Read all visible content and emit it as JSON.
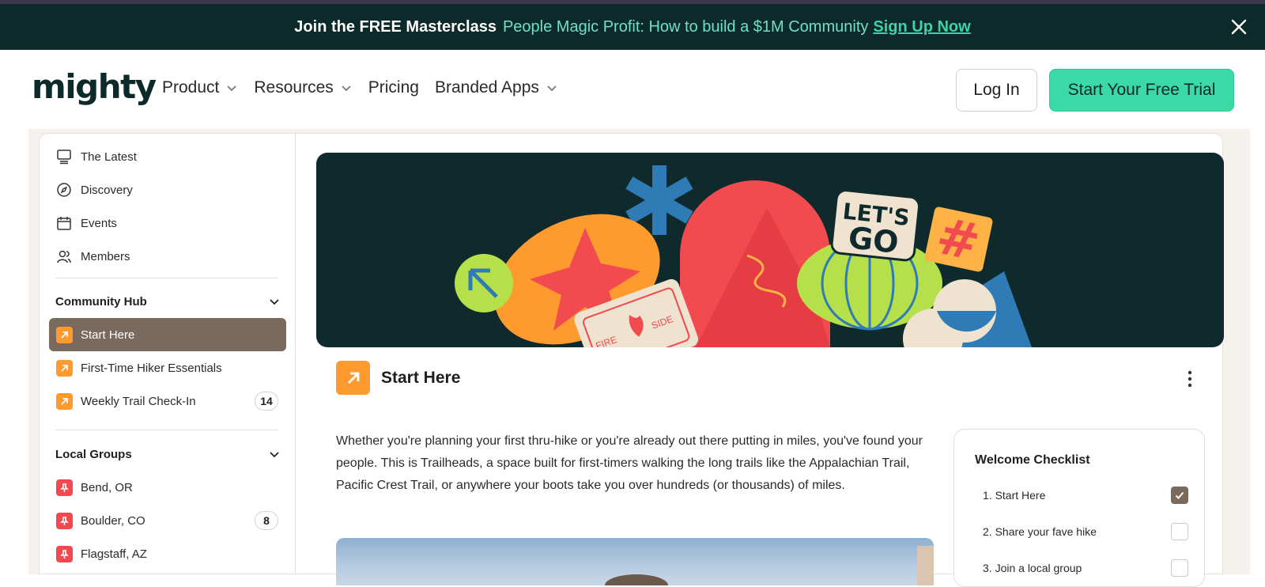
{
  "banner": {
    "bold": "Join the FREE Masterclass",
    "text": "People Magic Profit: How to build a $1M Community",
    "link": "Sign Up Now"
  },
  "nav": {
    "logo": "mighty",
    "menu": [
      "Product",
      "Resources",
      "Pricing",
      "Branded Apps"
    ],
    "login": "Log In",
    "trial": "Start Your Free Trial"
  },
  "sidebar": {
    "main_items": [
      "The Latest",
      "Discovery",
      "Events",
      "Members"
    ],
    "community_hub": {
      "title": "Community Hub",
      "items": [
        {
          "label": "Start Here",
          "count": ""
        },
        {
          "label": "First-Time Hiker Essentials",
          "count": ""
        },
        {
          "label": "Weekly Trail Check-In",
          "count": "14"
        }
      ]
    },
    "local_groups": {
      "title": "Local Groups",
      "items": [
        {
          "label": "Bend, OR",
          "count": ""
        },
        {
          "label": "Boulder, CO",
          "count": "8"
        },
        {
          "label": "Flagstaff, AZ",
          "count": ""
        }
      ]
    }
  },
  "hero": {
    "sticker_top": "LET'S",
    "sticker_bottom": "GO",
    "fire_left": "FIRE",
    "fire_right": "SIDE",
    "hash": "#"
  },
  "space": {
    "title": "Start Here",
    "description": "Whether you're planning your first thru-hike or you're already out there putting in miles, you've found your people. This is Trailheads, a space built for first-timers walking the long trails like the Appalachian Trail, Pacific Crest Trail, or anywhere your boots take you over hundreds (or thousands) of miles."
  },
  "checklist": {
    "title": "Welcome Checklist",
    "items": [
      {
        "label": "1. Start Here",
        "checked": true
      },
      {
        "label": "2. Share your fave hike",
        "checked": false
      },
      {
        "label": "3. Join a local group",
        "checked": false
      }
    ]
  },
  "colors": {
    "banner_bg": "#0d2a2a",
    "accent": "#3bd9a6",
    "active_item": "#7a6a5e",
    "orange_icon": "#ff9a2e",
    "red_icon": "#f5474f"
  }
}
